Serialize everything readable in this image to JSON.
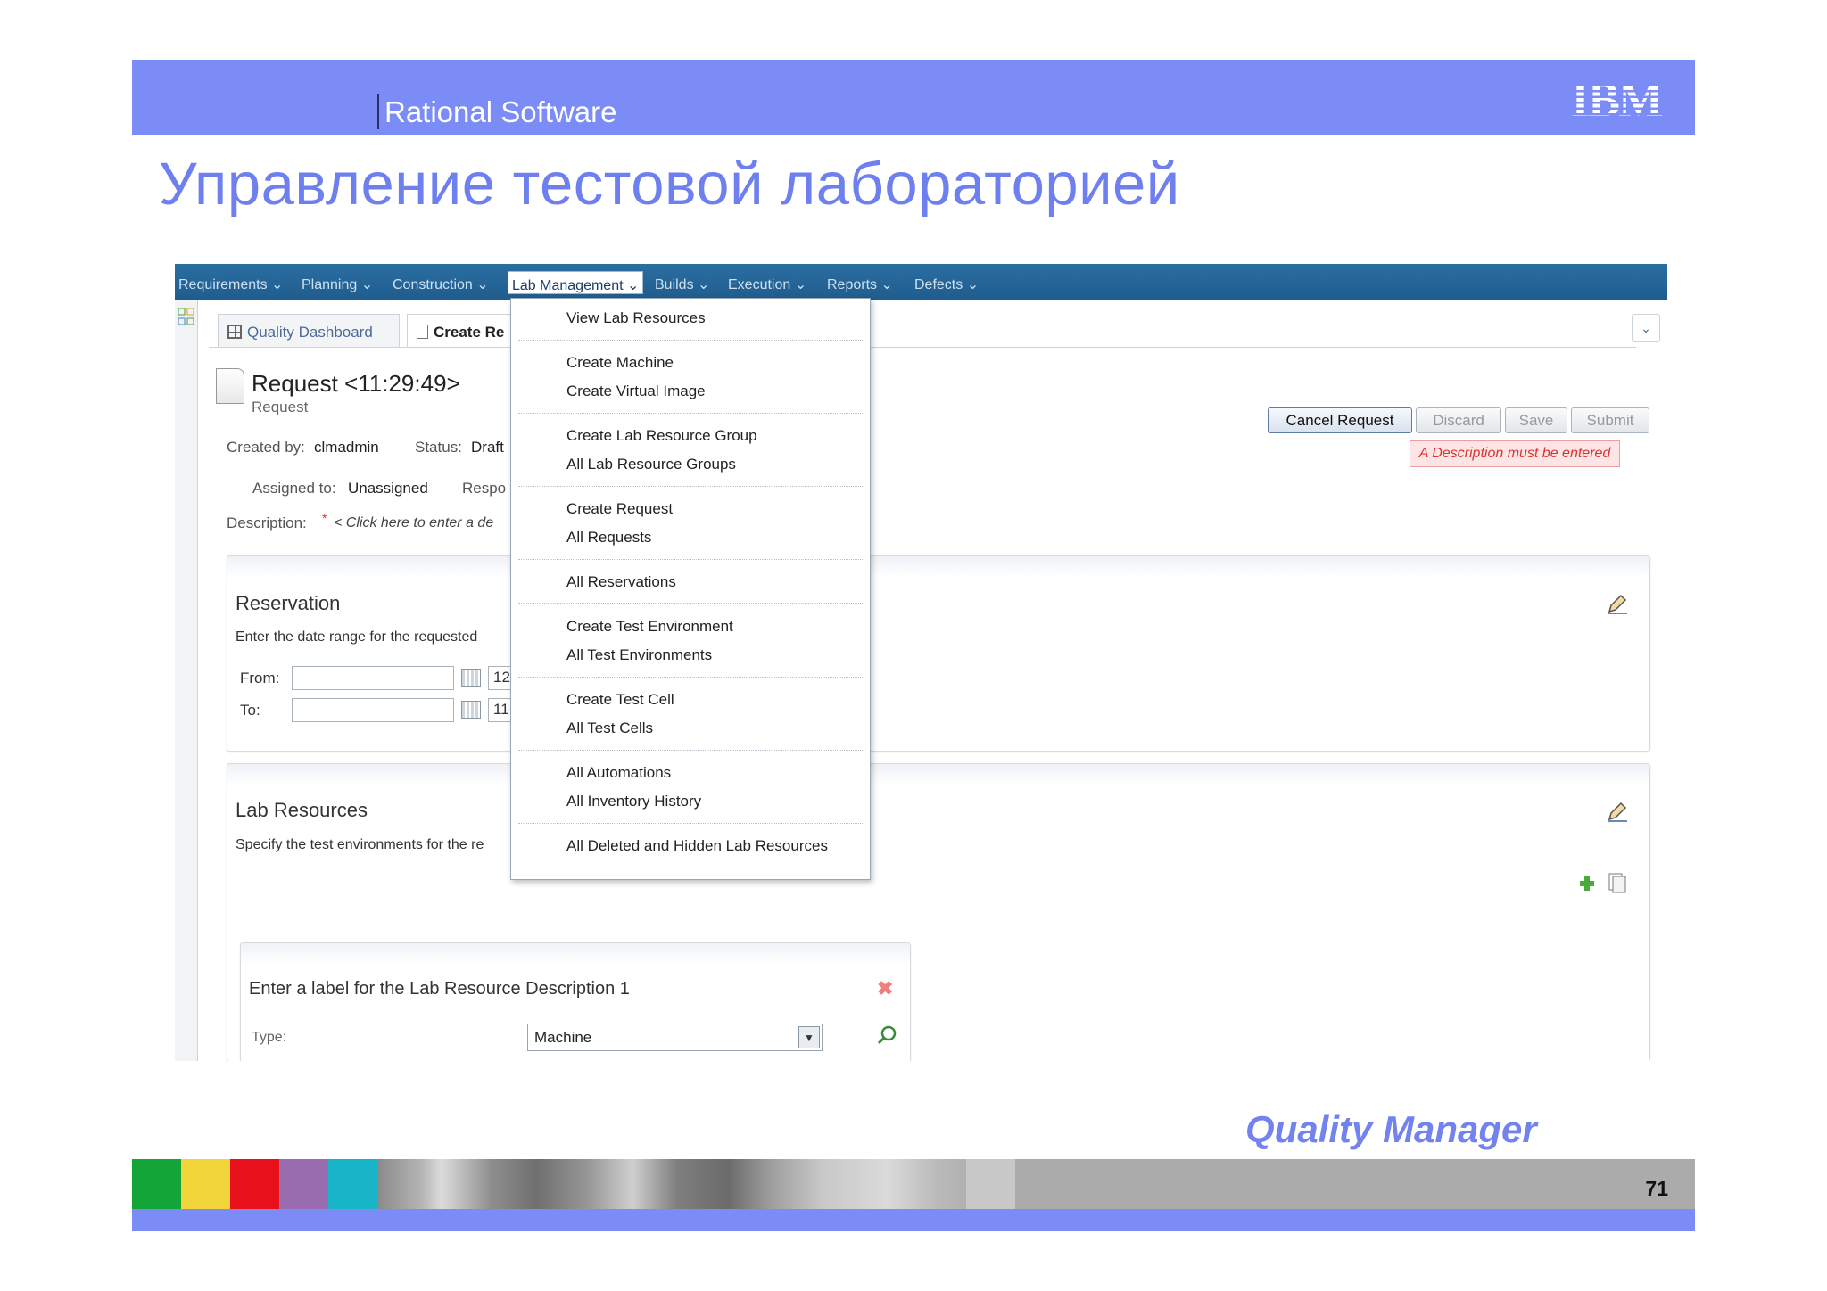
{
  "slide": {
    "brand": "Rational Software",
    "logo_text": "IBM",
    "title": "Управление тестовой лабораторией",
    "product": "Quality Manager",
    "page_number": "71",
    "accent_color": "#7b8cf7",
    "footer_colors": [
      "#13a538",
      "#f0d43a",
      "#e8101b",
      "#9a6db0",
      "#18b4c8"
    ]
  },
  "app": {
    "nav": [
      "Requirements",
      "Planning",
      "Construction",
      "Lab Management",
      "Builds",
      "Execution",
      "Reports",
      "Defects"
    ],
    "active_nav": "Lab Management",
    "tabs": [
      "Quality Dashboard",
      "Create Re"
    ],
    "request": {
      "title": "Request <11:29:49>",
      "subtitle": "Request",
      "created_by_label": "Created by:",
      "created_by": "clmadmin",
      "status_label": "Status:",
      "status": "Draft",
      "assigned_label": "Assigned to:",
      "assigned": "Unassigned",
      "resp_label": "Respo",
      "description_label": "Description:",
      "description_required": "*",
      "description_placeholder": "< Click here to enter a de"
    },
    "buttons": {
      "cancel": "Cancel Request",
      "discard": "Discard",
      "save": "Save",
      "submit": "Submit"
    },
    "warning": "A Description must be entered",
    "reservation": {
      "title": "Reservation",
      "hint": "Enter the date range for the requested",
      "from_label": "From:",
      "to_label": "To:",
      "from_time": "12",
      "to_time": "11"
    },
    "lab_resources": {
      "title": "Lab Resources",
      "hint": "Specify the test environments for the re",
      "description_title": "Enter a label for the Lab Resource Description 1",
      "type_label": "Type:",
      "type_value": "Machine"
    },
    "menu": {
      "groups": [
        [
          "View Lab Resources"
        ],
        [
          "Create Machine",
          "Create Virtual Image"
        ],
        [
          "Create Lab Resource Group",
          "All Lab Resource Groups"
        ],
        [
          "Create Request",
          "All Requests"
        ],
        [
          "All Reservations"
        ],
        [
          "Create Test Environment",
          "All Test Environments"
        ],
        [
          "Create Test Cell",
          "All Test Cells"
        ],
        [
          "All Automations",
          "All Inventory History"
        ],
        [
          "All Deleted and Hidden Lab Resources"
        ]
      ]
    }
  }
}
